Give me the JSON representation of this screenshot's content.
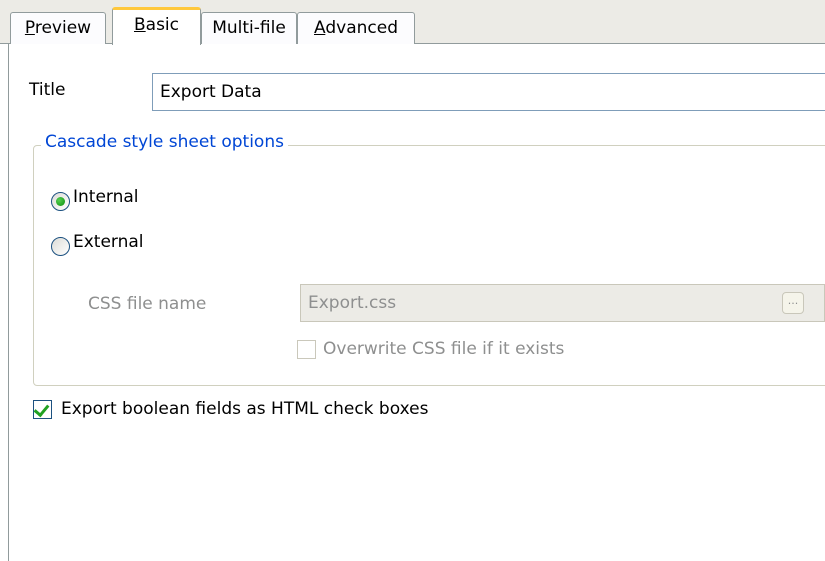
{
  "tabs": [
    {
      "label": "Preview",
      "mnemonic": "P",
      "rest": "review",
      "active": false
    },
    {
      "label": "Basic",
      "mnemonic": "B",
      "rest": "asic",
      "active": true
    },
    {
      "label": "Multi-file",
      "mnemonic": "",
      "rest": "Multi-file",
      "active": false
    },
    {
      "label": "Advanced",
      "mnemonic": "A",
      "rest": "dvanced",
      "active": false
    }
  ],
  "title_field": {
    "label": "Title",
    "value": "Export Data"
  },
  "css_group": {
    "legend": "Cascade style sheet options",
    "internal_label": "Internal",
    "internal_selected": true,
    "external_label": "External",
    "external_selected": false,
    "css_file_label": "CSS file name",
    "css_file_value": "Export.css",
    "browse_glyph": "...",
    "overwrite_label": "Overwrite CSS file if it exists",
    "overwrite_checked": false
  },
  "export_boolean": {
    "label": "Export boolean fields as HTML check boxes",
    "checked": true
  },
  "colors": {
    "legend": "#0046d5",
    "active_tab_accent": "#ffc83c",
    "check_green": "#21a121"
  }
}
